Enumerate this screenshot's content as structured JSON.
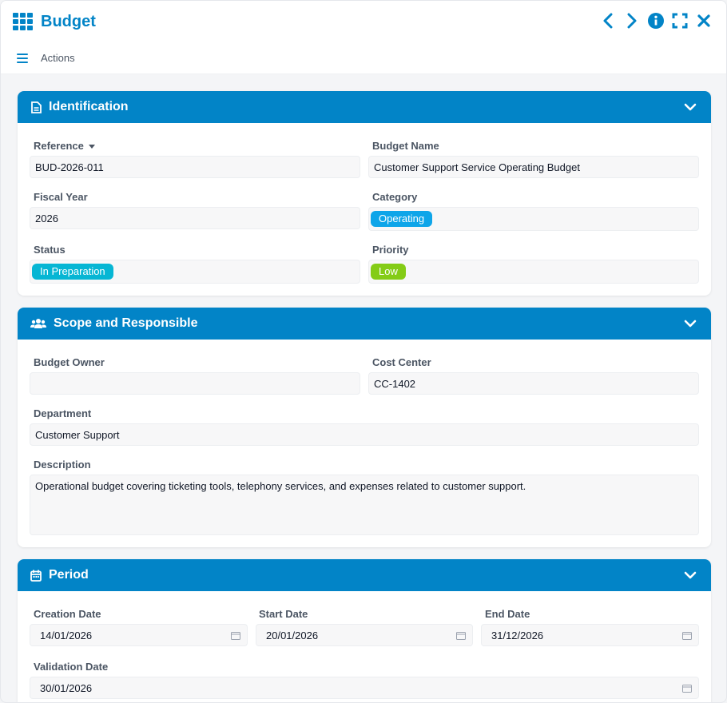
{
  "window": {
    "title": "Budget"
  },
  "toolbar": {
    "actions_label": "Actions"
  },
  "sections": {
    "identification": {
      "title": "Identification",
      "reference_label": "Reference",
      "reference_value": "BUD-2026-011",
      "budget_name_label": "Budget Name",
      "budget_name_value": "Customer Support Service Operating Budget",
      "fiscal_year_label": "Fiscal Year",
      "fiscal_year_value": "2026",
      "category_label": "Category",
      "category_value": "Operating",
      "status_label": "Status",
      "status_value": "In Preparation",
      "priority_label": "Priority",
      "priority_value": "Low"
    },
    "scope": {
      "title": "Scope and Responsible",
      "owner_label": "Budget Owner",
      "owner_value": "",
      "cost_center_label": "Cost Center",
      "cost_center_value": "CC-1402",
      "department_label": "Department",
      "department_value": "Customer Support",
      "description_label": "Description",
      "description_value": "Operational budget covering ticketing tools, telephony services, and expenses related to customer support."
    },
    "period": {
      "title": "Period",
      "creation_label": "Creation Date",
      "creation_value": "14/01/2026",
      "start_label": "Start Date",
      "start_value": "20/01/2026",
      "end_label": "End Date",
      "end_value": "31/12/2026",
      "validation_label": "Validation Date",
      "validation_value": "30/01/2026"
    }
  },
  "colors": {
    "accent": "#0284c7",
    "tag_operating": "#0ea5e9",
    "tag_status": "#06b6d4",
    "tag_priority": "#84cc16"
  },
  "icons": [
    "grid-icon",
    "chevron-left-icon",
    "chevron-right-icon",
    "info-icon",
    "fullscreen-icon",
    "close-icon",
    "menu-icon",
    "document-icon",
    "users-icon",
    "calendar-icon",
    "chevron-down-icon"
  ]
}
